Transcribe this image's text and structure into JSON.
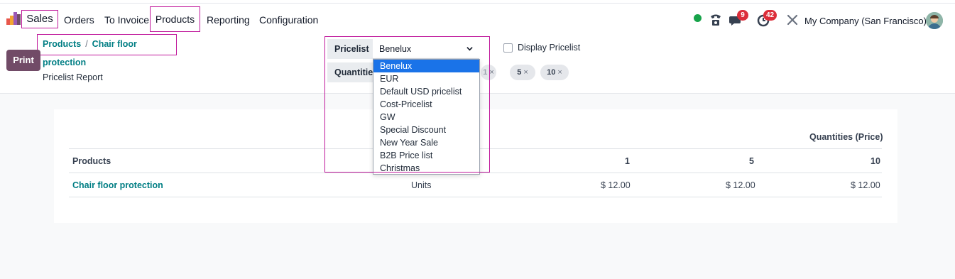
{
  "app": {
    "name": "Sales"
  },
  "menu": {
    "orders": "Orders",
    "to_invoice": "To Invoice",
    "products": "Products",
    "reporting": "Reporting",
    "configuration": "Configuration"
  },
  "systray": {
    "chat_badge": "9",
    "activity_badge": "42",
    "company": "My Company (San Francisco)",
    "status_color": "#17a34a"
  },
  "breadcrumb": {
    "parent": "Products",
    "separator": "/",
    "current": "Chair floor protection"
  },
  "actions": {
    "print_label": "Print"
  },
  "report": {
    "title": "Pricelist Report"
  },
  "filters": {
    "pricelist_label": "Pricelist",
    "pricelist_value": "Benelux",
    "quantities_label": "Quantities",
    "quantity_chips": [
      "1",
      "5",
      "10"
    ],
    "display_pricelist_label": "Display Pricelist",
    "display_pricelist_checked": false
  },
  "pricelist_options": [
    "Benelux",
    "EUR",
    "Default USD pricelist",
    "Cost-Pricelist",
    "GW",
    "Special Discount",
    "New Year Sale",
    "B2B Price list",
    "Christmas"
  ],
  "table": {
    "quantities_header": "Quantities (Price)",
    "columns": [
      "Products",
      "1",
      "5",
      "10"
    ],
    "rows": [
      {
        "product": "Chair floor protection",
        "uom": "Units",
        "prices": [
          "$ 12.00",
          "$ 12.00",
          "$ 12.00"
        ]
      }
    ]
  },
  "colors": {
    "primary": "#714b67",
    "link": "#017e84",
    "highlight": "#c0189b",
    "selection": "#1a73e8"
  }
}
